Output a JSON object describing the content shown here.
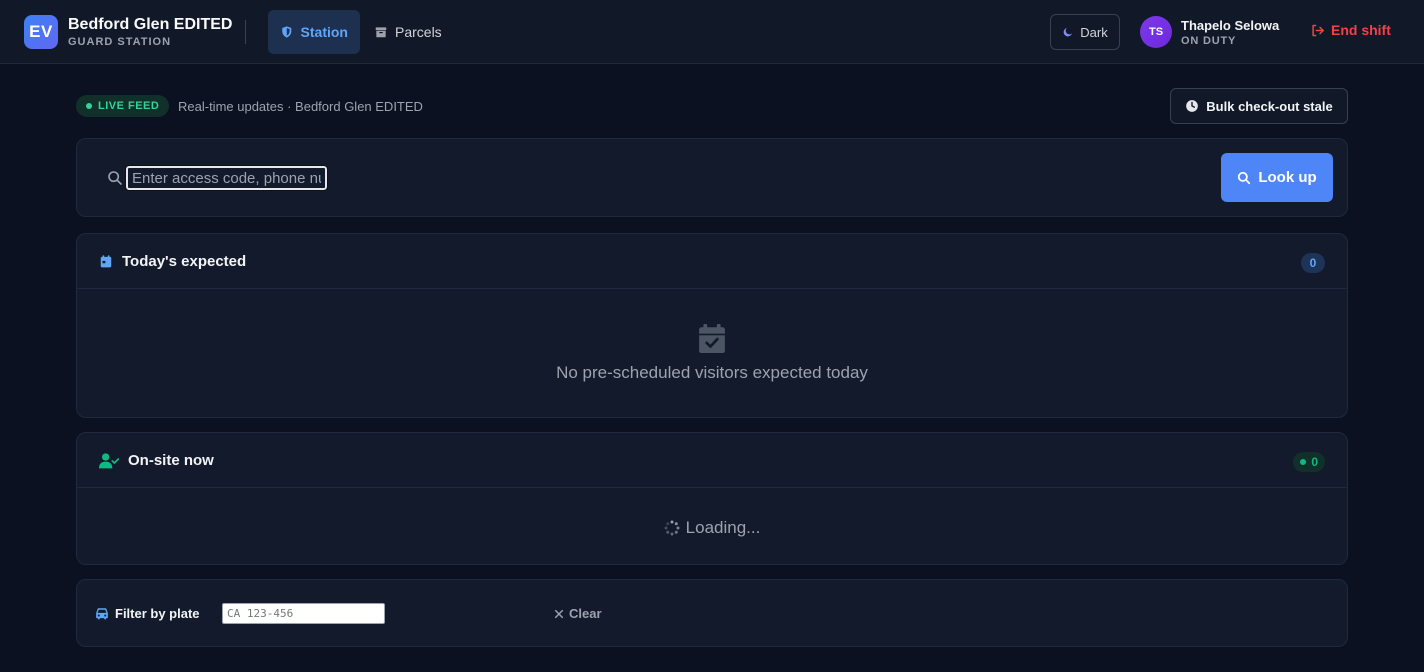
{
  "brand": {
    "logo": "EV",
    "name": "Bedford Glen EDITED",
    "subtitle": "GUARD STATION"
  },
  "nav": {
    "tabs": [
      {
        "label": "Station",
        "icon": "shield-icon",
        "active": true
      },
      {
        "label": "Parcels",
        "icon": "package-icon",
        "active": false
      }
    ]
  },
  "theme_toggle": {
    "label": "Dark",
    "icon": "moon-icon"
  },
  "user": {
    "initials": "TS",
    "name": "Thapelo Selowa",
    "status": "ON DUTY"
  },
  "end_shift": {
    "label": "End shift",
    "icon": "logout-icon"
  },
  "live": {
    "badge": "LIVE FEED",
    "text": "Real-time updates · Bedford Glen EDITED"
  },
  "bulk_checkout": {
    "label": "Bulk check-out stale",
    "icon": "clock-icon"
  },
  "search": {
    "placeholder": "Enter access code, phone number or name",
    "value": "",
    "button_label": "Look up"
  },
  "expected": {
    "title": "Today's expected",
    "count": "0",
    "empty_message": "No pre-scheduled visitors expected today"
  },
  "onsite": {
    "title": "On-site now",
    "count": "0",
    "loading_text": "Loading..."
  },
  "filter": {
    "label": "Filter by plate",
    "placeholder": "CA 123-456",
    "value": "",
    "clear_label": "Clear"
  },
  "colors": {
    "background": "#0b1120",
    "surface": "#121a2b",
    "accent": "#4f86f7",
    "danger": "#ef4444",
    "success": "#34d399"
  }
}
